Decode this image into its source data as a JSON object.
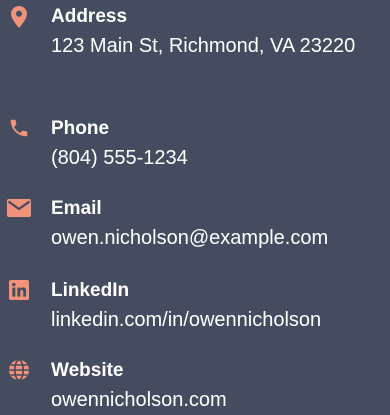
{
  "accent_color": "#f0937a",
  "background_color": "#454c5f",
  "contacts": [
    {
      "icon": "location-pin-icon",
      "label": "Address",
      "value": "123 Main St, Richmond, VA 23220"
    },
    {
      "icon": "phone-icon",
      "label": "Phone",
      "value": "(804) 555-1234"
    },
    {
      "icon": "envelope-icon",
      "label": "Email",
      "value": "owen.nicholson@example.com"
    },
    {
      "icon": "linkedin-icon",
      "label": "LinkedIn",
      "value": "linkedin.com/in/owennicholson"
    },
    {
      "icon": "globe-icon",
      "label": "Website",
      "value": "owennicholson.com"
    }
  ]
}
